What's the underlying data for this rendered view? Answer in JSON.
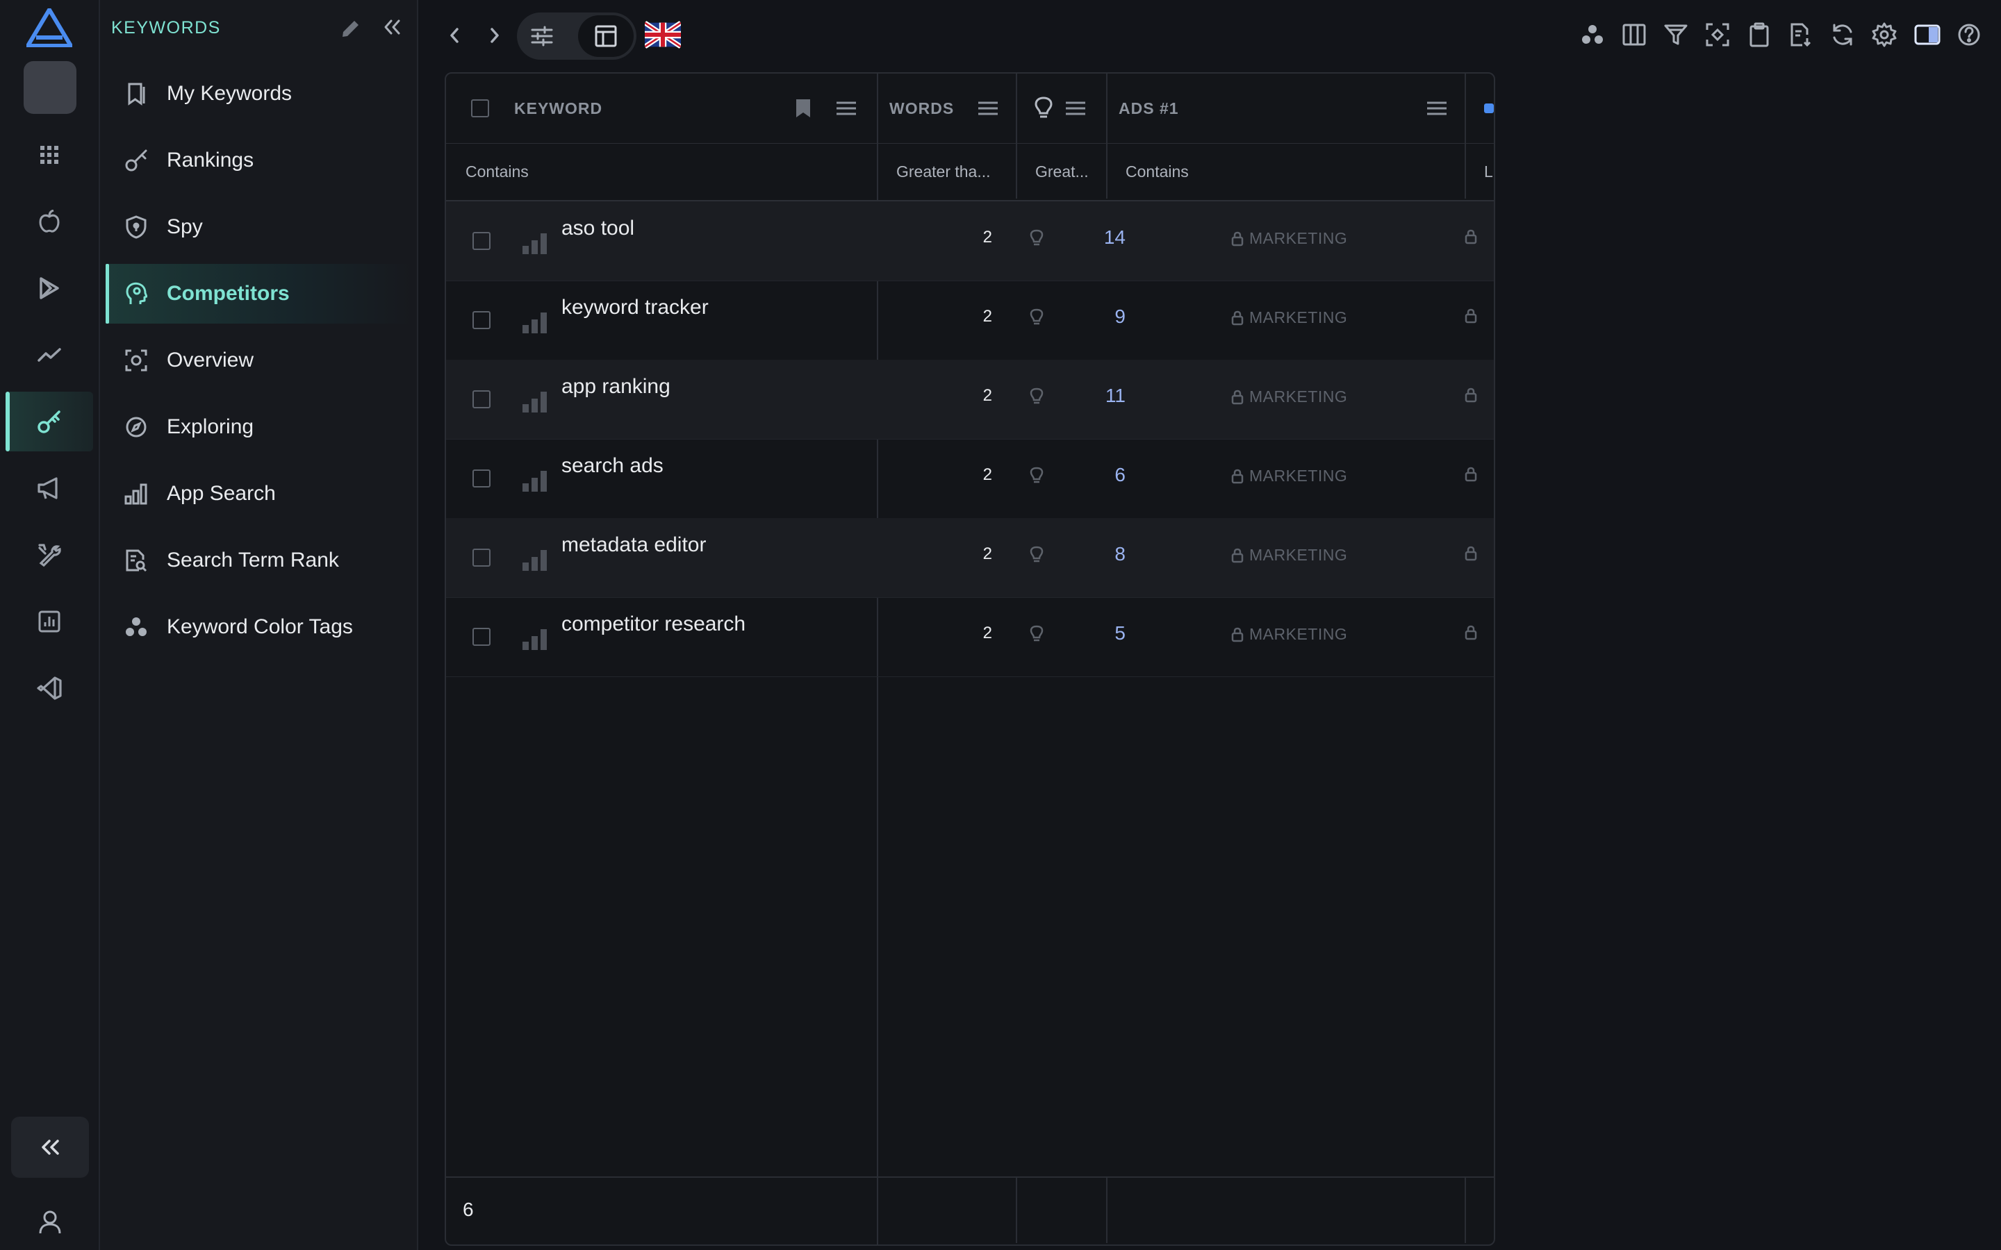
{
  "rail": {
    "items": [
      {
        "name": "grid"
      },
      {
        "name": "apple"
      },
      {
        "name": "play"
      },
      {
        "name": "trend"
      },
      {
        "name": "key",
        "active": true
      },
      {
        "name": "megaphone"
      },
      {
        "name": "tools"
      },
      {
        "name": "report"
      },
      {
        "name": "vscode"
      }
    ],
    "collapse_icon": "double-chevron-left-icon",
    "user_icon": "user-icon"
  },
  "sidebar": {
    "title": "KEYWORDS",
    "items": [
      {
        "label": "My Keywords",
        "icon": "bookmark-icon"
      },
      {
        "label": "Rankings",
        "icon": "key-icon"
      },
      {
        "label": "Spy",
        "icon": "shield-icon"
      },
      {
        "label": "Competitors",
        "icon": "head-icon",
        "active": true
      },
      {
        "label": "Overview",
        "icon": "scan-icon"
      },
      {
        "label": "Exploring",
        "icon": "compass-icon"
      },
      {
        "label": "App Search",
        "icon": "bar-chart-icon"
      },
      {
        "label": "Search Term Rank",
        "icon": "document-search-icon"
      },
      {
        "label": "Keyword Color Tags",
        "icon": "dots-icon"
      }
    ]
  },
  "toolbar": {
    "flag": "United Kingdom"
  },
  "table": {
    "headers": {
      "keyword": "KEYWORD",
      "words": "WORDS",
      "ads": "ADS #1",
      "more": ""
    },
    "filters": {
      "keyword": "Contains",
      "words": "Greater tha...",
      "popularity": "Great...",
      "ads": "Contains",
      "more": "L"
    },
    "rows": [
      {
        "keyword": "aso tool",
        "words": "2",
        "popularity": "14",
        "ads": "MARKETING"
      },
      {
        "keyword": "keyword tracker",
        "words": "2",
        "popularity": "9",
        "ads": "MARKETING"
      },
      {
        "keyword": "app ranking",
        "words": "2",
        "popularity": "11",
        "ads": "MARKETING"
      },
      {
        "keyword": "search ads",
        "words": "2",
        "popularity": "6",
        "ads": "MARKETING"
      },
      {
        "keyword": "metadata editor",
        "words": "2",
        "popularity": "8",
        "ads": "MARKETING"
      },
      {
        "keyword": "competitor research",
        "words": "2",
        "popularity": "5",
        "ads": "MARKETING"
      }
    ],
    "row_count": "6"
  },
  "colors": {
    "accent": "#7fe3d2",
    "popularity": "#9ab3f0",
    "background": "#121419"
  }
}
